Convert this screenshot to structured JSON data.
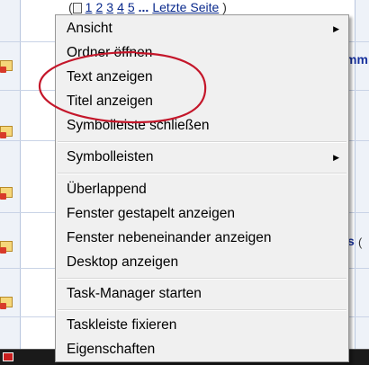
{
  "background": {
    "pagination": {
      "pages": [
        "1",
        "2",
        "3",
        "4",
        "5"
      ],
      "ellipsis": "...",
      "last_page": "Letzte Seite",
      "open_paren": "(",
      "close_paren": ")"
    },
    "right_text_1": "mm",
    "right_text_2": "s",
    "right_glyph": "("
  },
  "context_menu": {
    "items": [
      {
        "label": "Ansicht",
        "submenu": true
      },
      {
        "label": "Ordner öffnen",
        "submenu": false
      },
      {
        "label": "Text anzeigen",
        "submenu": false
      },
      {
        "label": "Titel anzeigen",
        "submenu": false
      },
      {
        "label": "Symbolleiste schließen",
        "submenu": false
      },
      {
        "label": "Symbolleisten",
        "submenu": true
      },
      {
        "label": "Überlappend",
        "submenu": false
      },
      {
        "label": "Fenster gestapelt anzeigen",
        "submenu": false
      },
      {
        "label": "Fenster nebeneinander anzeigen",
        "submenu": false
      },
      {
        "label": "Desktop anzeigen",
        "submenu": false
      },
      {
        "label": "Task-Manager starten",
        "submenu": false
      },
      {
        "label": "Taskleiste fixieren",
        "submenu": false
      },
      {
        "label": "Eigenschaften",
        "submenu": false
      }
    ],
    "submenu_arrow": "▶"
  },
  "colors": {
    "annotation_red": "#c4162a",
    "menu_background": "#f0f0f0",
    "link_blue": "#0a2a8c"
  }
}
